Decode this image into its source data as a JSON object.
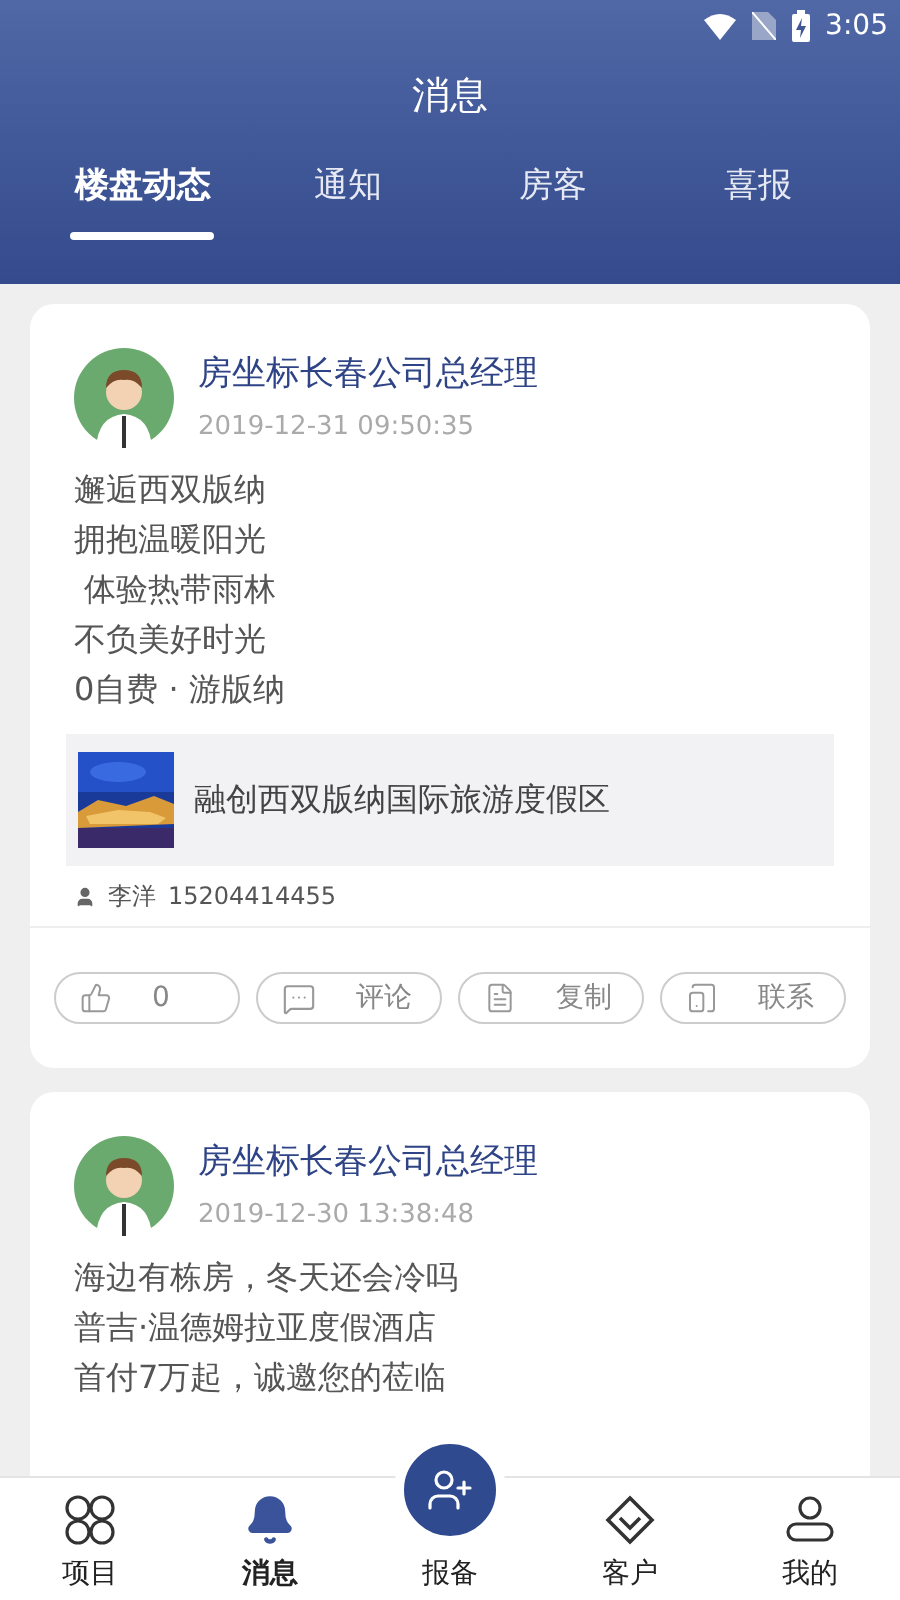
{
  "status_bar": {
    "time": "3:05"
  },
  "header": {
    "title": "消息"
  },
  "tabs": [
    {
      "label": "楼盘动态",
      "selected": true
    },
    {
      "label": "通知",
      "selected": false
    },
    {
      "label": "房客",
      "selected": false
    },
    {
      "label": "喜报",
      "selected": false
    }
  ],
  "posts": [
    {
      "author": "房坐标长春公司总经理",
      "time": "2019-12-31 09:50:35",
      "lines": [
        "邂逅西双版纳",
        "拥抱温暖阳光",
        " 体验热带雨林",
        "不负美好时光",
        "0自费 · 游版纳"
      ],
      "link": {
        "title": "融创西双版纳国际旅游度假区"
      },
      "contact": {
        "name": "李洋",
        "phone": "15204414455"
      },
      "actions": [
        {
          "kind": "like",
          "label": "0"
        },
        {
          "kind": "comment",
          "label": "评论"
        },
        {
          "kind": "copy",
          "label": "复制"
        },
        {
          "kind": "contact",
          "label": "联系"
        }
      ]
    },
    {
      "author": "房坐标长春公司总经理",
      "time": "2019-12-30 13:38:48",
      "lines": [
        "海边有栋房，冬天还会冷吗",
        "普吉·温德姆拉亚度假酒店",
        "首付7万起，诚邀您的莅临"
      ]
    }
  ],
  "bottom_nav": [
    {
      "kind": "grid",
      "label": "项目",
      "selected": false
    },
    {
      "kind": "bell",
      "label": "消息",
      "selected": true
    },
    {
      "kind": "center",
      "label": "报备",
      "selected": false
    },
    {
      "kind": "diamond",
      "label": "客户",
      "selected": false
    },
    {
      "kind": "user",
      "label": "我的",
      "selected": false
    }
  ]
}
